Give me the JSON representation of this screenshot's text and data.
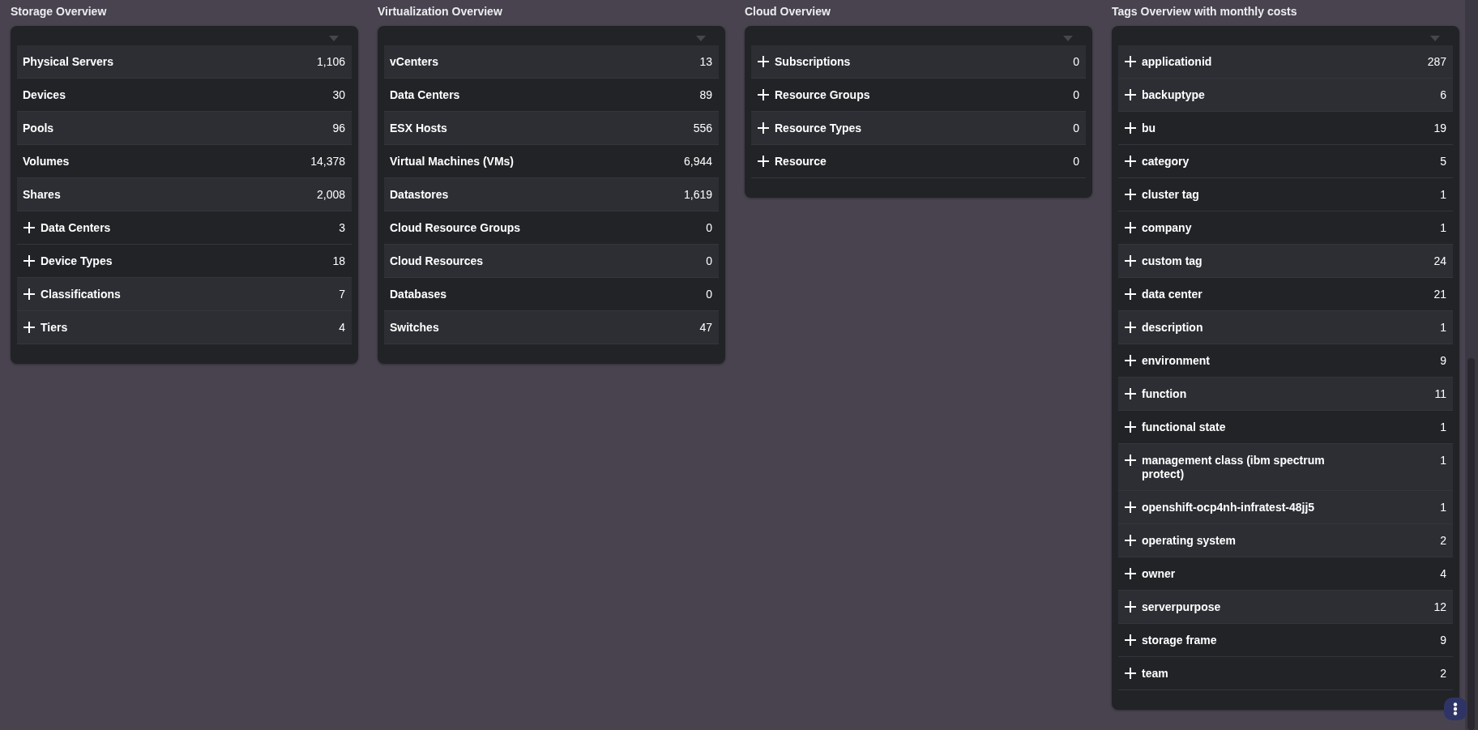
{
  "panels": [
    {
      "title": "Storage Overview",
      "rows": [
        {
          "label": "Physical Servers",
          "count": "1,106",
          "expandable": false,
          "highlighted": true
        },
        {
          "label": "Devices",
          "count": "30",
          "expandable": false,
          "highlighted": false
        },
        {
          "label": "Pools",
          "count": "96",
          "expandable": false,
          "highlighted": true
        },
        {
          "label": "Volumes",
          "count": "14,378",
          "expandable": false,
          "highlighted": false
        },
        {
          "label": "Shares",
          "count": "2,008",
          "expandable": false,
          "highlighted": true
        },
        {
          "label": "Data Centers",
          "count": "3",
          "expandable": true,
          "highlighted": false
        },
        {
          "label": "Device Types",
          "count": "18",
          "expandable": true,
          "highlighted": false
        },
        {
          "label": "Classifications",
          "count": "7",
          "expandable": true,
          "highlighted": true
        },
        {
          "label": "Tiers",
          "count": "4",
          "expandable": true,
          "highlighted": true
        }
      ]
    },
    {
      "title": "Virtualization Overview",
      "rows": [
        {
          "label": "vCenters",
          "count": "13",
          "expandable": false,
          "highlighted": true
        },
        {
          "label": "Data Centers",
          "count": "89",
          "expandable": false,
          "highlighted": false
        },
        {
          "label": "ESX Hosts",
          "count": "556",
          "expandable": false,
          "highlighted": true
        },
        {
          "label": "Virtual Machines (VMs)",
          "count": "6,944",
          "expandable": false,
          "highlighted": false
        },
        {
          "label": "Datastores",
          "count": "1,619",
          "expandable": false,
          "highlighted": true
        },
        {
          "label": "Cloud Resource Groups",
          "count": "0",
          "expandable": false,
          "highlighted": false
        },
        {
          "label": "Cloud Resources",
          "count": "0",
          "expandable": false,
          "highlighted": true
        },
        {
          "label": "Databases",
          "count": "0",
          "expandable": false,
          "highlighted": false
        },
        {
          "label": "Switches",
          "count": "47",
          "expandable": false,
          "highlighted": true
        }
      ]
    },
    {
      "title": "Cloud Overview",
      "rows": [
        {
          "label": "Subscriptions",
          "count": "0",
          "expandable": true,
          "highlighted": true
        },
        {
          "label": "Resource Groups",
          "count": "0",
          "expandable": true,
          "highlighted": false
        },
        {
          "label": "Resource Types",
          "count": "0",
          "expandable": true,
          "highlighted": true
        },
        {
          "label": "Resource",
          "count": "0",
          "expandable": true,
          "highlighted": false
        }
      ]
    },
    {
      "title": "Tags Overview with monthly costs",
      "rows": [
        {
          "label": "applicationid",
          "count": "287",
          "expandable": true,
          "highlighted": true
        },
        {
          "label": "backuptype",
          "count": "6",
          "expandable": true,
          "highlighted": true
        },
        {
          "label": "bu",
          "count": "19",
          "expandable": true,
          "highlighted": false
        },
        {
          "label": "category",
          "count": "5",
          "expandable": true,
          "highlighted": false
        },
        {
          "label": "cluster tag",
          "count": "1",
          "expandable": true,
          "highlighted": false
        },
        {
          "label": "company",
          "count": "1",
          "expandable": true,
          "highlighted": false
        },
        {
          "label": "custom tag",
          "count": "24",
          "expandable": true,
          "highlighted": true
        },
        {
          "label": "data center",
          "count": "21",
          "expandable": true,
          "highlighted": false
        },
        {
          "label": "description",
          "count": "1",
          "expandable": true,
          "highlighted": true
        },
        {
          "label": "environment",
          "count": "9",
          "expandable": true,
          "highlighted": false
        },
        {
          "label": "function",
          "count": "11",
          "expandable": true,
          "highlighted": true
        },
        {
          "label": "functional state",
          "count": "1",
          "expandable": true,
          "highlighted": false
        },
        {
          "label": "management class (ibm spectrum protect)",
          "count": "1",
          "expandable": true,
          "highlighted": true
        },
        {
          "label": "openshift-ocp4nh-infratest-48jj5",
          "count": "1",
          "expandable": true,
          "highlighted": true
        },
        {
          "label": "operating system",
          "count": "2",
          "expandable": true,
          "highlighted": true
        },
        {
          "label": "owner",
          "count": "4",
          "expandable": true,
          "highlighted": false
        },
        {
          "label": "serverpurpose",
          "count": "12",
          "expandable": true,
          "highlighted": true
        },
        {
          "label": "storage frame",
          "count": "9",
          "expandable": true,
          "highlighted": false
        },
        {
          "label": "team",
          "count": "2",
          "expandable": true,
          "highlighted": false
        }
      ]
    }
  ]
}
